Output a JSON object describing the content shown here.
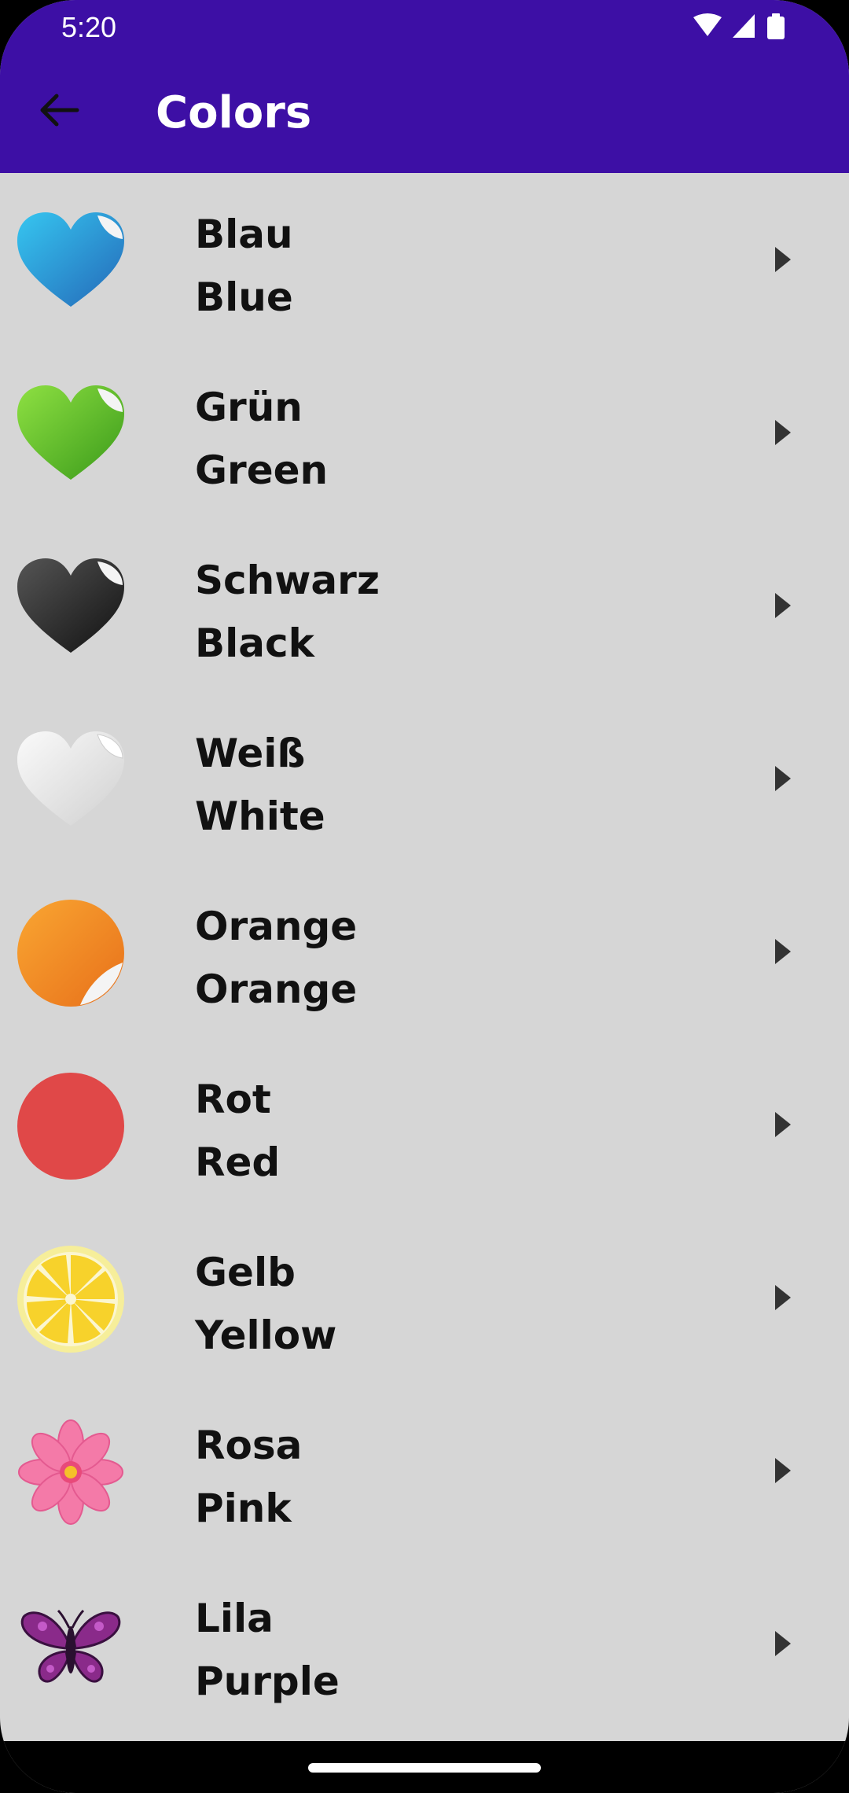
{
  "status_bar": {
    "time": "5:20"
  },
  "app_bar": {
    "title": "Colors",
    "back_icon": "arrow-left-icon"
  },
  "colors": [
    {
      "german": "Blau",
      "english": "Blue",
      "icon": "blue-heart-icon",
      "color": "#2f9bdc"
    },
    {
      "german": "Grün",
      "english": "Green",
      "icon": "green-heart-icon",
      "color": "#5fc42c"
    },
    {
      "german": "Schwarz",
      "english": "Black",
      "icon": "black-heart-icon",
      "color": "#2a2a2a"
    },
    {
      "german": "Weiß",
      "english": "White",
      "icon": "white-heart-icon",
      "color": "#f2f2f2"
    },
    {
      "german": "Orange",
      "english": "Orange",
      "icon": "orange-circle-icon",
      "color": "#f5901f"
    },
    {
      "german": "Rot",
      "english": "Red",
      "icon": "red-circle-icon",
      "color": "#e04848"
    },
    {
      "german": "Gelb",
      "english": "Yellow",
      "icon": "lemon-slice-icon",
      "color": "#f7d62b"
    },
    {
      "german": "Rosa",
      "english": "Pink",
      "icon": "pink-flower-icon",
      "color": "#f47aa8"
    },
    {
      "german": "Lila",
      "english": "Purple",
      "icon": "purple-butterfly-icon",
      "color": "#8a2a8a"
    }
  ],
  "theme": {
    "primary": "#3d0fa5",
    "background": "#d6d6d6"
  }
}
